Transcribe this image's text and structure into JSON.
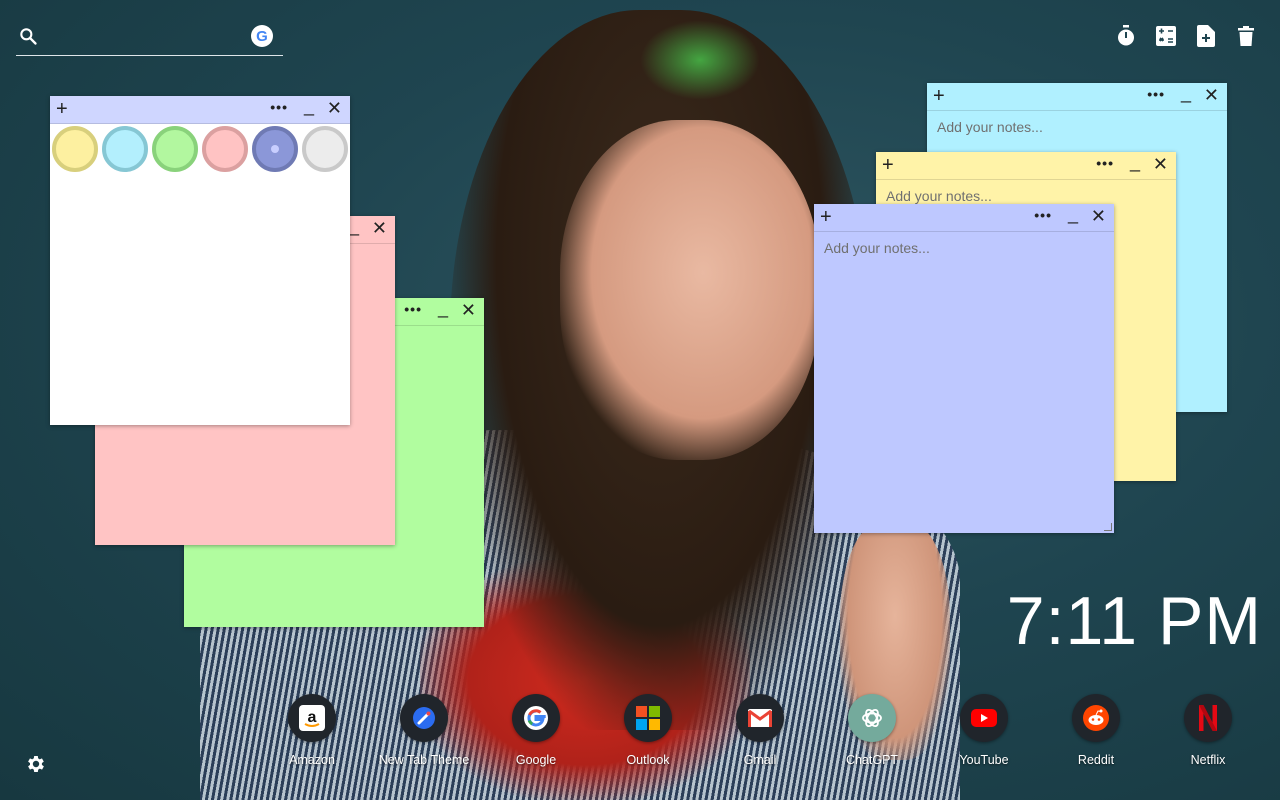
{
  "search": {
    "placeholder": "",
    "engine_icon": "google-icon",
    "engine_letter": "G"
  },
  "toolbar": {
    "items": [
      {
        "name": "timer-icon"
      },
      {
        "name": "calculator-icon"
      },
      {
        "name": "new-note-icon"
      },
      {
        "name": "trash-icon"
      }
    ]
  },
  "notes": {
    "add_glyph": "+",
    "more_glyph": "•••",
    "min_glyph": "_",
    "close_glyph": "✕",
    "placeholder": "Add your notes...",
    "colors": {
      "green": "#b1fd9f",
      "pink": "#ffc4c4",
      "white": "#ffffff",
      "cyan": "#b0f0ff",
      "yellow": "#fff3a8",
      "blue": "#bec8ff"
    },
    "palette": [
      {
        "name": "yellow",
        "fill": "#fdf0a0",
        "ring": "#d8cf7c"
      },
      {
        "name": "cyan",
        "fill": "#b3effd",
        "ring": "#86c7d4"
      },
      {
        "name": "green",
        "fill": "#b2f79f",
        "ring": "#89d27b"
      },
      {
        "name": "pink",
        "fill": "#ffc3c3",
        "ring": "#dba0a0"
      },
      {
        "name": "blue",
        "fill": "#8b97d8",
        "ring": "#6f7ab4",
        "selected": true
      },
      {
        "name": "white",
        "fill": "#ececec",
        "ring": "#c9c9c9"
      }
    ]
  },
  "clock": {
    "time": "7:11 PM"
  },
  "shortcuts": [
    {
      "label": "Amazon",
      "icon": "amazon-icon"
    },
    {
      "label": "New Tab Theme",
      "icon": "new-tab-theme-icon"
    },
    {
      "label": "Google",
      "icon": "google-icon"
    },
    {
      "label": "Outlook",
      "icon": "outlook-icon"
    },
    {
      "label": "Gmail",
      "icon": "gmail-icon"
    },
    {
      "label": "ChatGPT",
      "icon": "chatgpt-icon"
    },
    {
      "label": "YouTube",
      "icon": "youtube-icon"
    },
    {
      "label": "Reddit",
      "icon": "reddit-icon"
    },
    {
      "label": "Netflix",
      "icon": "netflix-icon"
    }
  ],
  "settings": {
    "icon": "gear-icon"
  }
}
